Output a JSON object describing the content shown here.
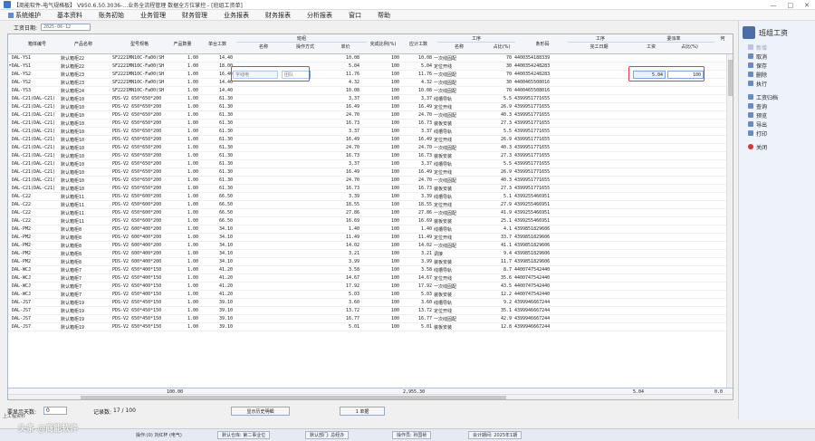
{
  "window": {
    "title": "【商能软件-电气规格板】 V950.6.50.3036-…业务全流程管理  数据全方位掌控 - [班组工资单]",
    "controls": [
      "—",
      "□",
      "✕"
    ]
  },
  "menu": [
    "系统维护",
    "基本资料",
    "账务初始",
    "业务管理",
    "财务管理",
    "业务报表",
    "财务报表",
    "分析报表",
    "窗口",
    "帮助"
  ],
  "toolbar": {
    "date_label": "工资日期:",
    "date_value": "2025-06-12"
  },
  "right_panel": {
    "title": "班组工资",
    "buttons": [
      {
        "icon": "new-icon",
        "label": "新增",
        "enabled": false
      },
      {
        "icon": "cancel-icon",
        "label": "取消",
        "enabled": true
      },
      {
        "icon": "save-icon",
        "label": "保存",
        "enabled": true
      },
      {
        "icon": "delete-icon",
        "label": "删除",
        "enabled": true
      },
      {
        "icon": "execute-icon",
        "label": "执行",
        "enabled": true
      },
      {
        "icon": "filter-icon",
        "label": "工资归档",
        "enabled": true
      },
      {
        "icon": "query-icon",
        "label": "查询",
        "enabled": true
      },
      {
        "icon": "preview-icon",
        "label": "预览",
        "enabled": true
      },
      {
        "icon": "export-icon",
        "label": "导出",
        "enabled": true
      },
      {
        "icon": "print-icon",
        "label": "打印",
        "enabled": true
      },
      {
        "icon": "close-icon",
        "label": "关闭",
        "enabled": true
      }
    ]
  },
  "grid": {
    "groups": {
      "worker": "班组",
      "process": "工序",
      "process2": "工序",
      "rate": "委派率"
    },
    "columns": {
      "box": "箱体编号",
      "product": "产品名称",
      "model": "型号规格",
      "qty": "产品数量",
      "unit_hours": "单台工数",
      "name": "名称",
      "op": "操作方式",
      "price": "单价",
      "ratio": "完成比例(%)",
      "total": "应计工数",
      "pname": "名称",
      "pratio": "占比(%)",
      "code": "条形码",
      "done_date": "完工日期",
      "work": "工资",
      "share": "占比(%)",
      "extra": "何"
    },
    "rows": [
      [
        "DAL-YS1",
        "默认箱柜22",
        "SF2221MN10C-Fa00(SH",
        "1.00",
        "14.40",
        "",
        "",
        "10.08",
        "100",
        "10.08",
        "一次线固配",
        "70",
        "4400354188339"
      ],
      [
        "DAL-YS1",
        "默认箱柜22",
        "SF2221MN10C-Fa00(SH",
        "1.00",
        "18.00",
        "字线电",
        "团队",
        "5.04",
        "100",
        "5.04",
        "定位开线",
        "30",
        "4400354248283"
      ],
      [
        "DAL-YS2",
        "默认箱柜23",
        "SF2221MN10C-Fa00(SH",
        "1.00",
        "16.40",
        "",
        "",
        "11.76",
        "100",
        "11.76",
        "一次线固配",
        "70",
        "4400354248283"
      ],
      [
        "DAL-YS2",
        "默认箱柜23",
        "SF2221MN10C-Fa00(SH",
        "1.00",
        "14.40",
        "",
        "",
        "4.32",
        "100",
        "4.32",
        "一次线固配",
        "30",
        "4400465508016"
      ],
      [
        "DAL-YS3",
        "默认箱柜24",
        "SF2221MN10C-Fa00(SH",
        "1.00",
        "14.40",
        "",
        "",
        "10.08",
        "100",
        "10.08",
        "一次线固配",
        "70",
        "4400465508016"
      ],
      [
        "DAL-C21(DAL-C21)",
        "默认箱柜10",
        "PDS-V2 650*650*200",
        "1.00",
        "61.30",
        "",
        "",
        "3.37",
        "100",
        "3.37",
        "线槽导轨",
        "5.5",
        "4399951771655"
      ],
      [
        "DAL-C21(DAL-C21)",
        "默认箱柜10",
        "PDS-V2 650*650*200",
        "1.00",
        "61.30",
        "",
        "",
        "16.49",
        "100",
        "16.49",
        "定位开线",
        "26.9",
        "4399951771655"
      ],
      [
        "DAL-C21(DAL-C21)",
        "默认箱柜10",
        "PDS-V2 650*650*200",
        "1.00",
        "61.30",
        "",
        "",
        "24.70",
        "100",
        "24.70",
        "一次线固配",
        "40.3",
        "4399951771655"
      ],
      [
        "DAL-C21(DAL-C21)",
        "默认箱柜10",
        "PDS-V2 650*650*200",
        "1.00",
        "61.30",
        "",
        "",
        "16.73",
        "100",
        "16.73",
        "装板安装",
        "27.3",
        "4399951771655"
      ],
      [
        "DAL-C21(DAL-C21)",
        "默认箱柜10",
        "PDS-V2 650*650*200",
        "1.00",
        "61.30",
        "",
        "",
        "3.37",
        "100",
        "3.37",
        "线槽导轨",
        "5.5",
        "4399951771655"
      ],
      [
        "DAL-C21(DAL-C21)",
        "默认箱柜10",
        "PDS-V2 650*650*200",
        "1.00",
        "61.30",
        "",
        "",
        "16.49",
        "100",
        "16.49",
        "定位开线",
        "26.9",
        "4399951771655"
      ],
      [
        "DAL-C21(DAL-C21)",
        "默认箱柜10",
        "PDS-V2 650*650*200",
        "1.00",
        "61.30",
        "",
        "",
        "24.70",
        "100",
        "24.70",
        "一次线固配",
        "40.3",
        "4399951771655"
      ],
      [
        "DAL-C21(DAL-C21)",
        "默认箱柜10",
        "PDS-V2 650*650*200",
        "1.00",
        "61.30",
        "",
        "",
        "16.73",
        "100",
        "16.73",
        "装板安装",
        "27.3",
        "4399951771655"
      ],
      [
        "DAL-C21(DAL-C21)",
        "默认箱柜10",
        "PDS-V2 650*650*200",
        "1.00",
        "61.30",
        "",
        "",
        "3.37",
        "100",
        "3.37",
        "线槽导轨",
        "5.5",
        "4399951771655"
      ],
      [
        "DAL-C21(DAL-C21)",
        "默认箱柜10",
        "PDS-V2 650*650*200",
        "1.00",
        "61.30",
        "",
        "",
        "16.49",
        "100",
        "16.49",
        "定位开线",
        "26.9",
        "4399951771655"
      ],
      [
        "DAL-C21(DAL-C21)",
        "默认箱柜10",
        "PDS-V2 650*650*200",
        "1.00",
        "61.30",
        "",
        "",
        "24.70",
        "100",
        "24.70",
        "一次线固配",
        "40.3",
        "4399951771655"
      ],
      [
        "DAL-C21(DAL-C21)",
        "默认箱柜10",
        "PDS-V2 650*650*200",
        "1.00",
        "61.30",
        "",
        "",
        "16.73",
        "100",
        "16.73",
        "装板安装",
        "27.3",
        "4399951771655"
      ],
      [
        "DAL-C22",
        "默认箱柜11",
        "PDS-V2 650*600*200",
        "1.00",
        "66.50",
        "",
        "",
        "3.39",
        "100",
        "3.39",
        "线槽导轨",
        "5.1",
        "4399255466951"
      ],
      [
        "DAL-C22",
        "默认箱柜11",
        "PDS-V2 650*600*200",
        "1.00",
        "66.50",
        "",
        "",
        "18.55",
        "100",
        "18.55",
        "定位开线",
        "27.9",
        "4399255466951"
      ],
      [
        "DAL-C22",
        "默认箱柜11",
        "PDS-V2 650*600*200",
        "1.00",
        "66.50",
        "",
        "",
        "27.86",
        "100",
        "27.86",
        "一次线固配",
        "41.9",
        "4399255466951"
      ],
      [
        "DAL-C22",
        "默认箱柜11",
        "PDS-V2 650*600*200",
        "1.00",
        "66.50",
        "",
        "",
        "16.69",
        "100",
        "16.69",
        "装板安装",
        "25.1",
        "4399255466951"
      ],
      [
        "DAL-PM2",
        "默认箱柜8",
        "PDS-V2 600*400*200",
        "1.00",
        "34.10",
        "",
        "",
        "1.40",
        "100",
        "1.40",
        "线槽导轨",
        "4.1",
        "4399851829606"
      ],
      [
        "DAL-PM2",
        "默认箱柜8",
        "PDS-V2 600*400*200",
        "1.00",
        "34.10",
        "",
        "",
        "11.49",
        "100",
        "11.49",
        "定位开线",
        "33.7",
        "4399851829606"
      ],
      [
        "DAL-PM2",
        "默认箱柜8",
        "PDS-V2 600*400*200",
        "1.00",
        "34.10",
        "",
        "",
        "14.02",
        "100",
        "14.02",
        "一次线固配",
        "41.1",
        "4399851829606"
      ],
      [
        "DAL-PM2",
        "默认箱柜8",
        "PDS-V2 600*400*200",
        "1.00",
        "34.10",
        "",
        "",
        "3.21",
        "100",
        "3.21",
        "调接",
        "9.4",
        "4399851829606"
      ],
      [
        "DAL-PM2",
        "默认箱柜8",
        "PDS-V2 600*400*200",
        "1.00",
        "34.10",
        "",
        "",
        "3.99",
        "100",
        "3.99",
        "装板安装",
        "11.7",
        "4399851829606"
      ],
      [
        "DAL-WCJ",
        "默认箱柜7",
        "PDS-V2 650*400*150",
        "1.00",
        "41.20",
        "",
        "",
        "3.58",
        "100",
        "3.58",
        "线槽导轨",
        "8.7",
        "4400747542440"
      ],
      [
        "DAL-WCJ",
        "默认箱柜7",
        "PDS-V2 650*400*150",
        "1.00",
        "41.20",
        "",
        "",
        "14.67",
        "100",
        "14.67",
        "定位开线",
        "35.6",
        "4400747542440"
      ],
      [
        "DAL-WCJ",
        "默认箱柜7",
        "PDS-V2 650*400*150",
        "1.00",
        "41.20",
        "",
        "",
        "17.92",
        "100",
        "17.92",
        "一次线固配",
        "43.5",
        "4400747542440"
      ],
      [
        "DAL-WCJ",
        "默认箱柜7",
        "PDS-V2 650*400*150",
        "1.00",
        "41.20",
        "",
        "",
        "5.03",
        "100",
        "5.03",
        "装板安装",
        "12.2",
        "4400747542440"
      ],
      [
        "DAL-JS7",
        "默认箱柜19",
        "PDS-V2 650*450*150",
        "1.00",
        "39.10",
        "",
        "",
        "3.60",
        "100",
        "3.60",
        "线槽导轨",
        "9.2",
        "4399946667244"
      ],
      [
        "DAL-JS7",
        "默认箱柜19",
        "PDS-V2 650*450*150",
        "1.00",
        "39.10",
        "",
        "",
        "13.72",
        "100",
        "13.72",
        "定位开线",
        "35.1",
        "4399946667244"
      ],
      [
        "DAL-JS7",
        "默认箱柜19",
        "PDS-V2 650*450*150",
        "1.00",
        "39.10",
        "",
        "",
        "16.77",
        "100",
        "16.77",
        "一次线固配",
        "42.9",
        "4399946667244"
      ],
      [
        "DAL-JS7",
        "默认箱柜19",
        "PDS-V2 650*450*150",
        "1.00",
        "39.10",
        "",
        "",
        "5.01",
        "100",
        "5.01",
        "装板安装",
        "12.8",
        "4399946667244"
      ]
    ],
    "edit_row": {
      "work": "5.04",
      "share": "100"
    },
    "totals": {
      "qty": "100.00",
      "total": "2,955.30",
      "work": "5.04",
      "extra": "0.0"
    }
  },
  "bottom": {
    "days_label": "要显示天数:",
    "days_value": "0",
    "record_label": "记录数:",
    "record_value": "17 / 100",
    "history_btn": "显示历史明细",
    "single_btn": "1 单据",
    "side_tab": "上工程资料"
  },
  "status": {
    "operator": "操作:(0) 刘红杯 (电气)",
    "unit": "默认仓库: 第二事业位",
    "dept": "默认部门: 总经办",
    "user": "操作员: 孙国祯",
    "period": "会计期间: 2025年1期"
  },
  "watermark": "头条 @商能软件"
}
